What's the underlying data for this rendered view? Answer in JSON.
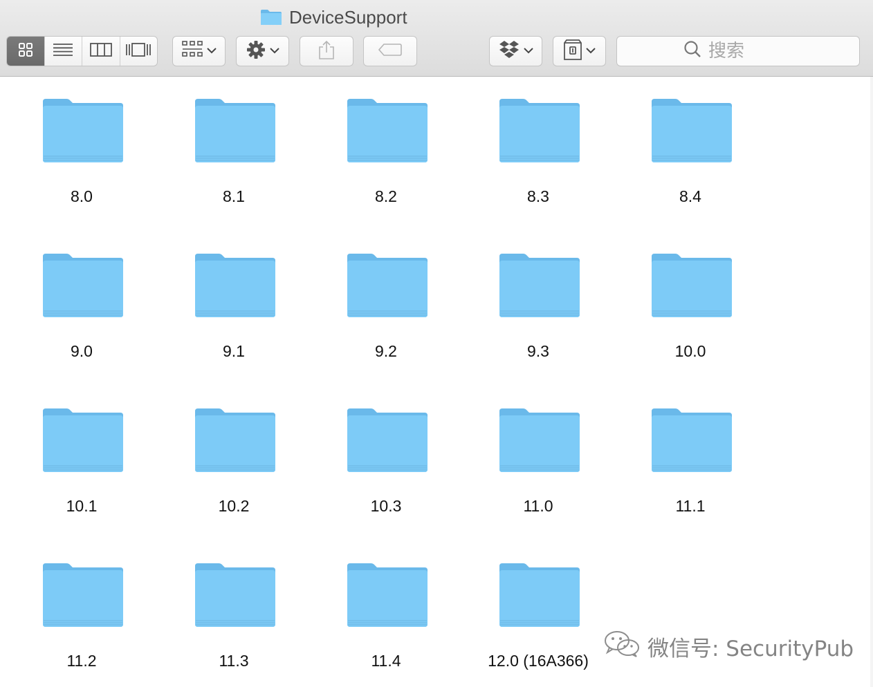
{
  "window": {
    "title": "DeviceSupport"
  },
  "toolbar": {
    "view_modes": [
      {
        "name": "icon-view",
        "active": true
      },
      {
        "name": "list-view",
        "active": false
      },
      {
        "name": "column-view",
        "active": false
      },
      {
        "name": "cover-flow-view",
        "active": false
      }
    ],
    "search": {
      "placeholder": "搜索"
    }
  },
  "icons": {
    "folder_color": "#7dcbf7",
    "folder_dark": "#6ab9ea"
  },
  "folders": [
    {
      "label": "8.0"
    },
    {
      "label": "8.1"
    },
    {
      "label": "8.2"
    },
    {
      "label": "8.3"
    },
    {
      "label": "8.4"
    },
    {
      "label": "9.0"
    },
    {
      "label": "9.1"
    },
    {
      "label": "9.2"
    },
    {
      "label": "9.3"
    },
    {
      "label": "10.0"
    },
    {
      "label": "10.1"
    },
    {
      "label": "10.2"
    },
    {
      "label": "10.3"
    },
    {
      "label": "11.0"
    },
    {
      "label": "11.1"
    },
    {
      "label": "11.2"
    },
    {
      "label": "11.3"
    },
    {
      "label": "11.4"
    },
    {
      "label": "12.0 (16A366)"
    }
  ],
  "watermark": {
    "text": "微信号: SecurityPub"
  }
}
